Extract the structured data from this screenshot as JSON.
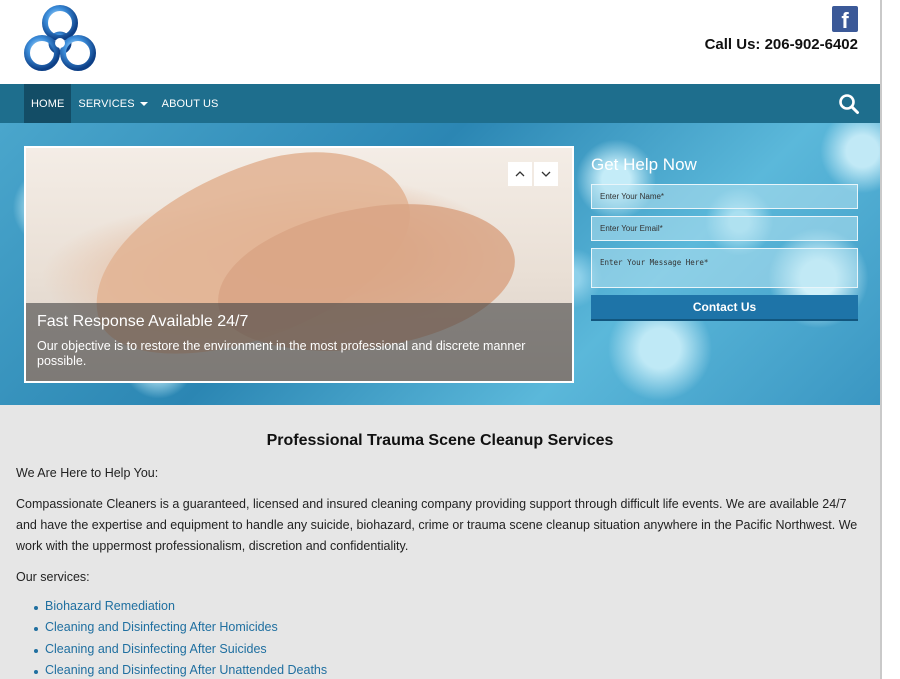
{
  "header": {
    "logo_icon": "biohazard-logo-icon",
    "facebook_icon": "facebook-icon",
    "call_us": "Call Us: 206-902-6402"
  },
  "nav": {
    "items": [
      {
        "label": "HOME",
        "active": true
      },
      {
        "label": "SERVICES",
        "dropdown": true
      },
      {
        "label": "ABOUT US"
      }
    ],
    "search_icon": "search-icon"
  },
  "slider": {
    "title": "Fast Response Available 24/7",
    "text": "Our objective is to restore the environment in the most professional and discrete manner possible.",
    "prev_icon": "chevron-up-icon",
    "next_icon": "chevron-down-icon"
  },
  "form": {
    "title": "Get Help Now",
    "name_placeholder": "Enter Your Name*",
    "email_placeholder": "Enter Your Email*",
    "message_placeholder": "Enter Your Message Here*",
    "submit_label": "Contact Us"
  },
  "content": {
    "heading": "Professional Trauma Scene Cleanup Services",
    "intro": "We Are Here to Help You:",
    "paragraph": "Compassionate Cleaners is a guaranteed, licensed and insured cleaning company providing support through difficult life events. We are available 24/7 and have the expertise and equipment to handle any suicide, biohazard, crime or trauma scene cleanup situation anywhere in the Pacific Northwest. We work with the uppermost professionalism, discretion and confidentiality.",
    "services_label": "Our services:",
    "services": [
      "Biohazard Remediation",
      "Cleaning and Disinfecting After Homicides",
      "Cleaning and Disinfecting After Suicides",
      "Cleaning and Disinfecting After Unattended Deaths"
    ]
  },
  "colors": {
    "nav_bg": "#1e6e8d",
    "nav_active": "#134d66",
    "link": "#1f6fa0",
    "button": "#1e74a8"
  }
}
